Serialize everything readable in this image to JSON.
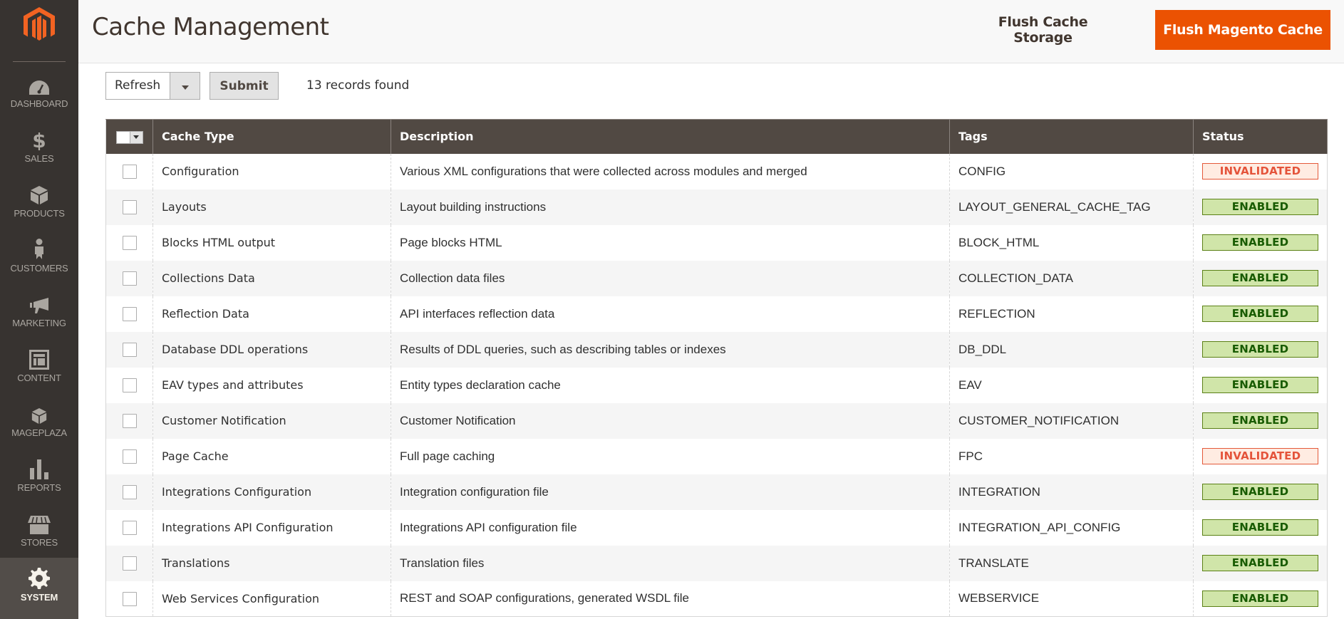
{
  "sidebar": {
    "logo": "magento-logo",
    "items": [
      {
        "label": "Dashboard",
        "icon": "dashboard-icon",
        "active": false
      },
      {
        "label": "Sales",
        "icon": "dollar-icon",
        "active": false
      },
      {
        "label": "Products",
        "icon": "box-icon",
        "active": false
      },
      {
        "label": "Customers",
        "icon": "person-icon",
        "active": false
      },
      {
        "label": "Marketing",
        "icon": "megaphone-icon",
        "active": false
      },
      {
        "label": "Content",
        "icon": "layout-icon",
        "active": false
      },
      {
        "label": "Mageplaza",
        "icon": "box-icon",
        "active": false
      },
      {
        "label": "Reports",
        "icon": "bar-chart-icon",
        "active": false
      },
      {
        "label": "Stores",
        "icon": "storefront-icon",
        "active": false
      },
      {
        "label": "System",
        "icon": "gear-icon",
        "active": true
      }
    ]
  },
  "header": {
    "title": "Cache Management",
    "flush_storage_label": "Flush Cache Storage",
    "flush_magento_label": "Flush Magento Cache"
  },
  "toolbar": {
    "mass_action_selected": "Refresh",
    "submit_label": "Submit",
    "records_found": "13 records found"
  },
  "grid": {
    "columns": [
      "",
      "Cache Type",
      "Description",
      "Tags",
      "Status"
    ],
    "rows": [
      {
        "type": "Configuration",
        "description": "Various XML configurations that were collected across modules and merged",
        "tags": "CONFIG",
        "status": "INVALIDATED",
        "checked": false
      },
      {
        "type": "Layouts",
        "description": "Layout building instructions",
        "tags": "LAYOUT_GENERAL_CACHE_TAG",
        "status": "ENABLED",
        "checked": false
      },
      {
        "type": "Blocks HTML output",
        "description": "Page blocks HTML",
        "tags": "BLOCK_HTML",
        "status": "ENABLED",
        "checked": false
      },
      {
        "type": "Collections Data",
        "description": "Collection data files",
        "tags": "COLLECTION_DATA",
        "status": "ENABLED",
        "checked": false
      },
      {
        "type": "Reflection Data",
        "description": "API interfaces reflection data",
        "tags": "REFLECTION",
        "status": "ENABLED",
        "checked": false
      },
      {
        "type": "Database DDL operations",
        "description": "Results of DDL queries, such as describing tables or indexes",
        "tags": "DB_DDL",
        "status": "ENABLED",
        "checked": false
      },
      {
        "type": "EAV types and attributes",
        "description": "Entity types declaration cache",
        "tags": "EAV",
        "status": "ENABLED",
        "checked": false
      },
      {
        "type": "Customer Notification",
        "description": "Customer Notification",
        "tags": "CUSTOMER_NOTIFICATION",
        "status": "ENABLED",
        "checked": false
      },
      {
        "type": "Page Cache",
        "description": "Full page caching",
        "tags": "FPC",
        "status": "INVALIDATED",
        "checked": false
      },
      {
        "type": "Integrations Configuration",
        "description": "Integration configuration file",
        "tags": "INTEGRATION",
        "status": "ENABLED",
        "checked": false
      },
      {
        "type": "Integrations API Configuration",
        "description": "Integrations API configuration file",
        "tags": "INTEGRATION_API_CONFIG",
        "status": "ENABLED",
        "checked": false
      },
      {
        "type": "Translations",
        "description": "Translation files",
        "tags": "TRANSLATE",
        "status": "ENABLED",
        "checked": false
      },
      {
        "type": "Web Services Configuration",
        "description": "REST and SOAP configurations, generated WSDL file",
        "tags": "WEBSERVICE",
        "status": "ENABLED",
        "checked": false
      }
    ]
  },
  "colors": {
    "sidebar_bg": "#373330",
    "accent": "#eb5202",
    "grid_header_bg": "#514943",
    "enabled_bg": "#d0e5a9",
    "enabled_text": "#185b00",
    "invalidated_bg": "#ffece2",
    "invalidated_text": "#e4533a"
  }
}
